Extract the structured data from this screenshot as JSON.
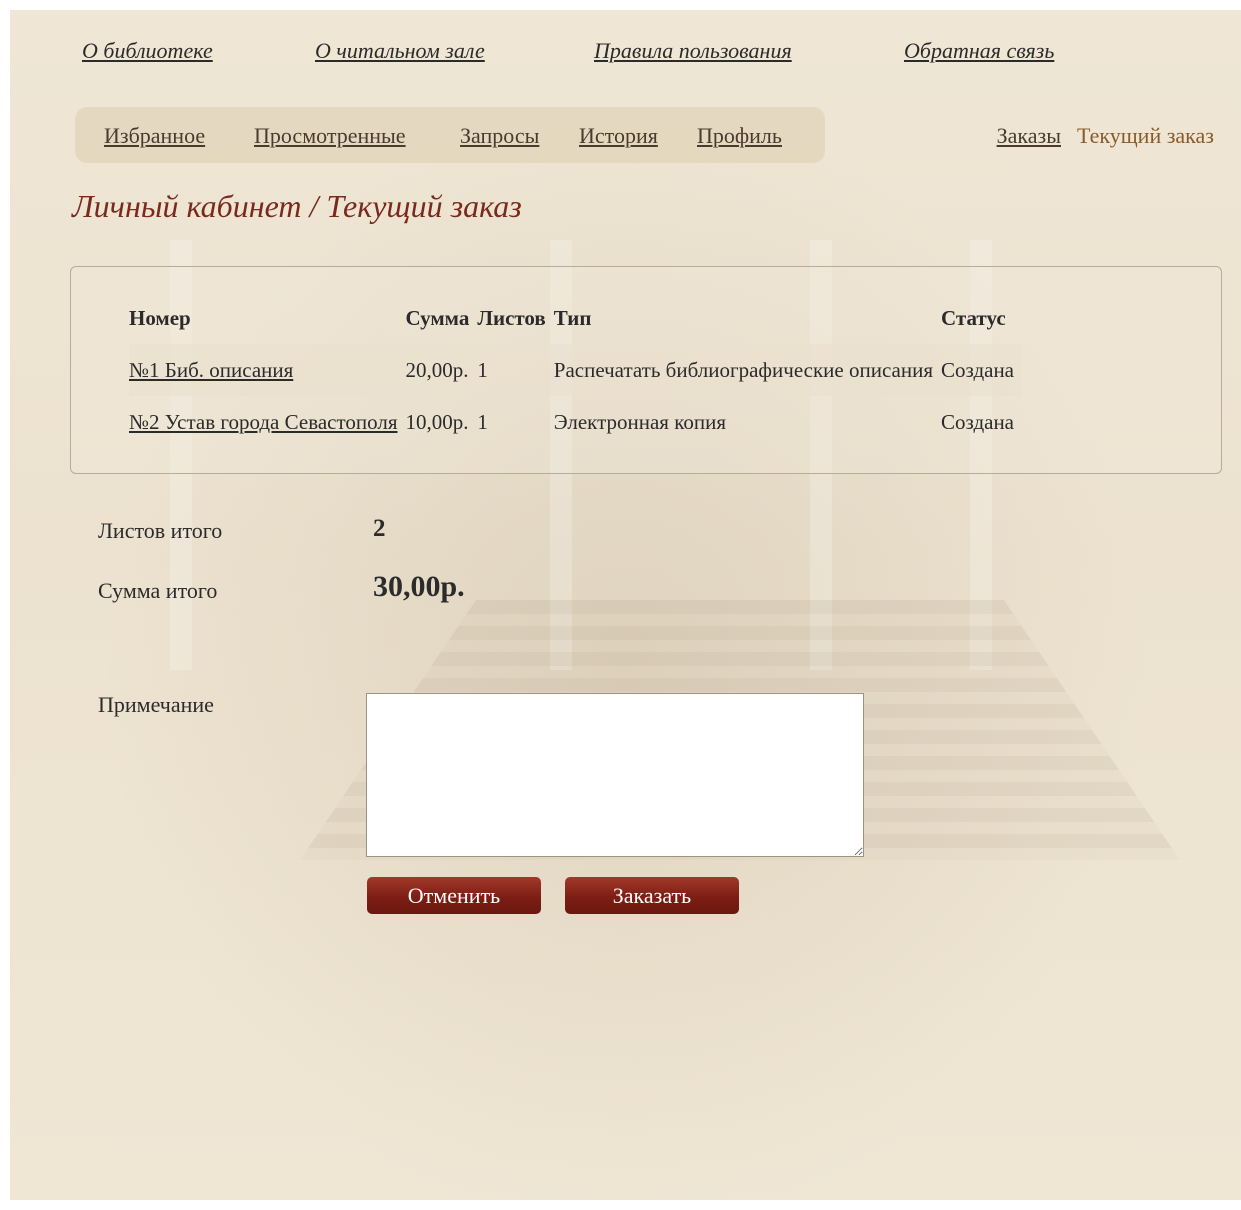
{
  "top_nav": {
    "about": "О библиотеке",
    "reading_room": "О читальном зале",
    "rules": "Правила пользования",
    "feedback": "Обратная связь"
  },
  "sub_nav": {
    "favorites": "Избранное",
    "viewed": "Просмотренные",
    "requests": "Запросы",
    "history": "История",
    "profile": "Профиль"
  },
  "right_nav": {
    "orders": "Заказы",
    "current_order": "Текущий заказ"
  },
  "page_title": "Личный кабинет / Текущий заказ",
  "orders": {
    "headers": [
      "Номер",
      "Сумма",
      "Листов",
      "Тип",
      "Статус"
    ],
    "rows": [
      {
        "number": "№1 Биб. описания",
        "sum": "20,00р.",
        "sheets": "1",
        "type": "Распечатать библиографические описания",
        "status": "Создана"
      },
      {
        "number": "№2 Устав города Севастополя",
        "sum": "10,00р.",
        "sheets": "1",
        "type": "Электронная копия",
        "status": "Создана"
      }
    ]
  },
  "totals": {
    "sheets_label": "Листов итого",
    "sheets_value": "2",
    "sum_label": "Сумма итого",
    "sum_value": "30,00р."
  },
  "note": {
    "label": "Примечание",
    "value": ""
  },
  "buttons": {
    "cancel": "Отменить",
    "order": "Заказать"
  },
  "colors": {
    "background": "#efe6d4",
    "title": "#7a2a1c",
    "button": "#7d1e14",
    "active_link": "#8a5a2a"
  }
}
